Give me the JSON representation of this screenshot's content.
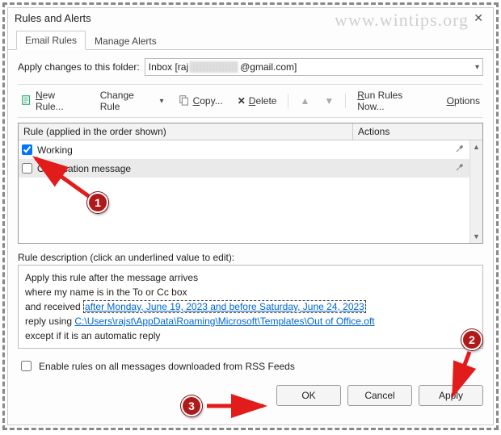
{
  "window": {
    "title": "Rules and Alerts",
    "watermark": "www.wintips.org"
  },
  "tabs": {
    "email_rules": "Email Rules",
    "manage_alerts": "Manage Alerts"
  },
  "folder": {
    "label": "Apply changes to this folder:",
    "prefix": "Inbox [raj",
    "suffix": "@gmail.com]"
  },
  "toolbar": {
    "new_rule": "New Rule...",
    "change_rule": "Change Rule",
    "copy": "Copy...",
    "delete": "Delete",
    "run_rules": "Run Rules Now...",
    "options": "Options"
  },
  "rules_table": {
    "header_rule": "Rule (applied in the order shown)",
    "header_actions": "Actions",
    "rows": [
      {
        "checked": true,
        "name": "Working"
      },
      {
        "checked": false,
        "name": "On vacation message"
      }
    ]
  },
  "description": {
    "label": "Rule description (click an underlined value to edit):",
    "line1": "Apply this rule after the message arrives",
    "line2": "where my name is in the To or Cc box",
    "line3_prefix": "  and received ",
    "line3_link": "after Monday, June 19, 2023 and before Saturday, June 24, 2023",
    "line4_prefix": "reply using ",
    "line4_link": "C:\\Users\\rajst\\AppData\\Roaming\\Microsoft\\Templates\\Out of Office.oft",
    "line5": "except if it is an automatic reply"
  },
  "rss_checkbox": {
    "label": "Enable rules on all messages downloaded from RSS Feeds"
  },
  "buttons": {
    "ok": "OK",
    "cancel": "Cancel",
    "apply": "Apply"
  },
  "annotations": {
    "b1": "1",
    "b2": "2",
    "b3": "3"
  }
}
